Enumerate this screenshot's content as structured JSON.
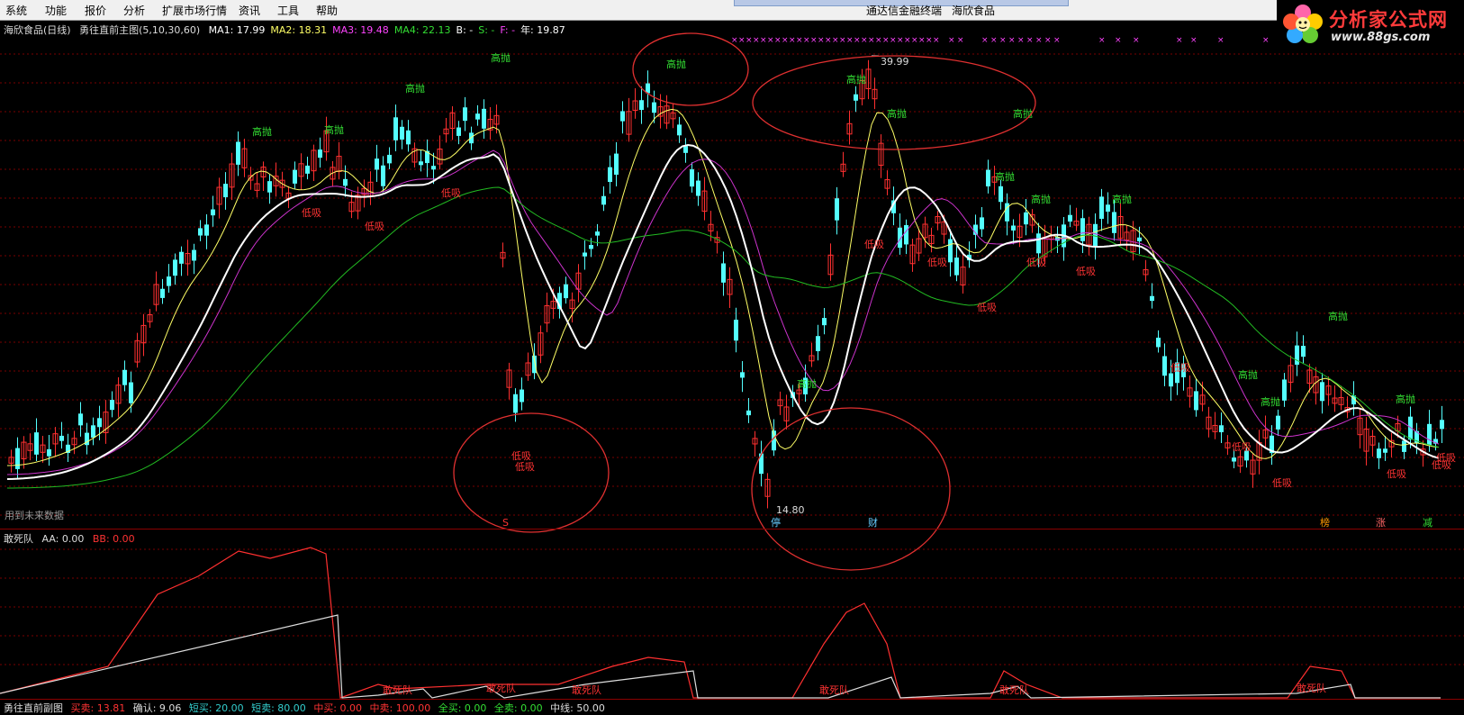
{
  "menu": [
    "系统",
    "功能",
    "报价",
    "分析",
    "扩展市场行情",
    "资讯",
    "工具",
    "帮助"
  ],
  "window_title": "通达信金融终端",
  "stock_name_title": "海欣食品",
  "logo": {
    "brand": "分析家公式网",
    "url": "www.88gs.com"
  },
  "main_chart": {
    "stock": "海欣食品(日线)",
    "formula": "勇往直前主图(5,10,30,60)",
    "indicators": [
      {
        "label": "MA1: 17.99",
        "color": "#ffffff"
      },
      {
        "label": "MA2: 18.31",
        "color": "#ffff66"
      },
      {
        "label": "MA3: 19.48",
        "color": "#ff44ff"
      },
      {
        "label": "MA4: 22.13",
        "color": "#33dd33"
      },
      {
        "label": "B: -",
        "color": "#ffffff"
      },
      {
        "label": "S: -",
        "color": "#33dd33"
      },
      {
        "label": "F: -",
        "color": "#ff44ff"
      },
      {
        "label": "年: 19.87",
        "color": "#ffffff"
      }
    ],
    "high_price": "39.99",
    "low_price": "14.80",
    "future_data_note": "用到未来数据",
    "signal_high": "高抛",
    "signal_low": "低吸",
    "bottom_markers": [
      {
        "text": "停",
        "color": "#66ccff"
      },
      {
        "text": "财",
        "color": "#66ccff"
      },
      {
        "text": "榜",
        "color": "#ff9900"
      },
      {
        "text": "涨",
        "color": "#ff6666"
      },
      {
        "text": "减",
        "color": "#33dd33"
      }
    ]
  },
  "sub_chart": {
    "name": "敢死队",
    "indicators": [
      {
        "label": "AA: 0.00",
        "color": "#dddddd"
      },
      {
        "label": "BB: 0.00",
        "color": "#ff3333"
      }
    ],
    "label": "敢死队"
  },
  "bottom_bar": {
    "name": "勇往直前副图",
    "items": [
      {
        "label": "买卖: 13.81",
        "color": "#ff3333"
      },
      {
        "label": "确认: 9.06",
        "color": "#dddddd"
      },
      {
        "label": "短买: 20.00",
        "color": "#33cccc"
      },
      {
        "label": "短卖: 80.00",
        "color": "#33cccc"
      },
      {
        "label": "中买: 0.00",
        "color": "#ff3333"
      },
      {
        "label": "中卖: 100.00",
        "color": "#ff3333"
      },
      {
        "label": "全买: 0.00",
        "color": "#33dd33"
      },
      {
        "label": "全卖: 0.00",
        "color": "#33dd33"
      },
      {
        "label": "中线: 50.00",
        "color": "#dddddd"
      }
    ]
  },
  "colors": {
    "up": "#ff3030",
    "down": "#54ffff",
    "grid": "#7a0000",
    "ma1": "#ffffff",
    "ma2": "#ffff66",
    "ma3": "#cc33cc",
    "ma4": "#22bb22"
  }
}
